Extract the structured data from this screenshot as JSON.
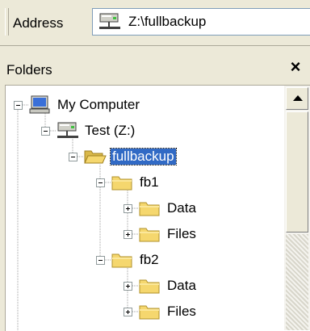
{
  "address_bar": {
    "label": "Address",
    "value": "Z:\\fullbackup",
    "icon": "network-drive-icon"
  },
  "folders_pane": {
    "title": "Folders",
    "close_label": "×"
  },
  "tree": [
    {
      "label": "My Computer",
      "icon": "computer-icon",
      "expanded": true,
      "level": 0
    },
    {
      "label": "Test (Z:)",
      "icon": "network-drive-icon",
      "expanded": true,
      "level": 1
    },
    {
      "label": "fullbackup",
      "icon": "open-folder-icon",
      "expanded": true,
      "level": 2,
      "selected": true
    },
    {
      "label": "fb1",
      "icon": "folder-icon",
      "expanded": true,
      "level": 3
    },
    {
      "label": "Data",
      "icon": "folder-icon",
      "expanded": false,
      "level": 4
    },
    {
      "label": "Files",
      "icon": "folder-icon",
      "expanded": false,
      "level": 4
    },
    {
      "label": "fb2",
      "icon": "folder-icon",
      "expanded": true,
      "level": 3
    },
    {
      "label": "Data",
      "icon": "folder-icon",
      "expanded": false,
      "level": 4
    },
    {
      "label": "Files",
      "icon": "folder-icon",
      "expanded": false,
      "level": 4
    }
  ],
  "colors": {
    "selection": "#316ac5",
    "folder": "#f5d76e",
    "toolbar": "#ece9d8"
  }
}
